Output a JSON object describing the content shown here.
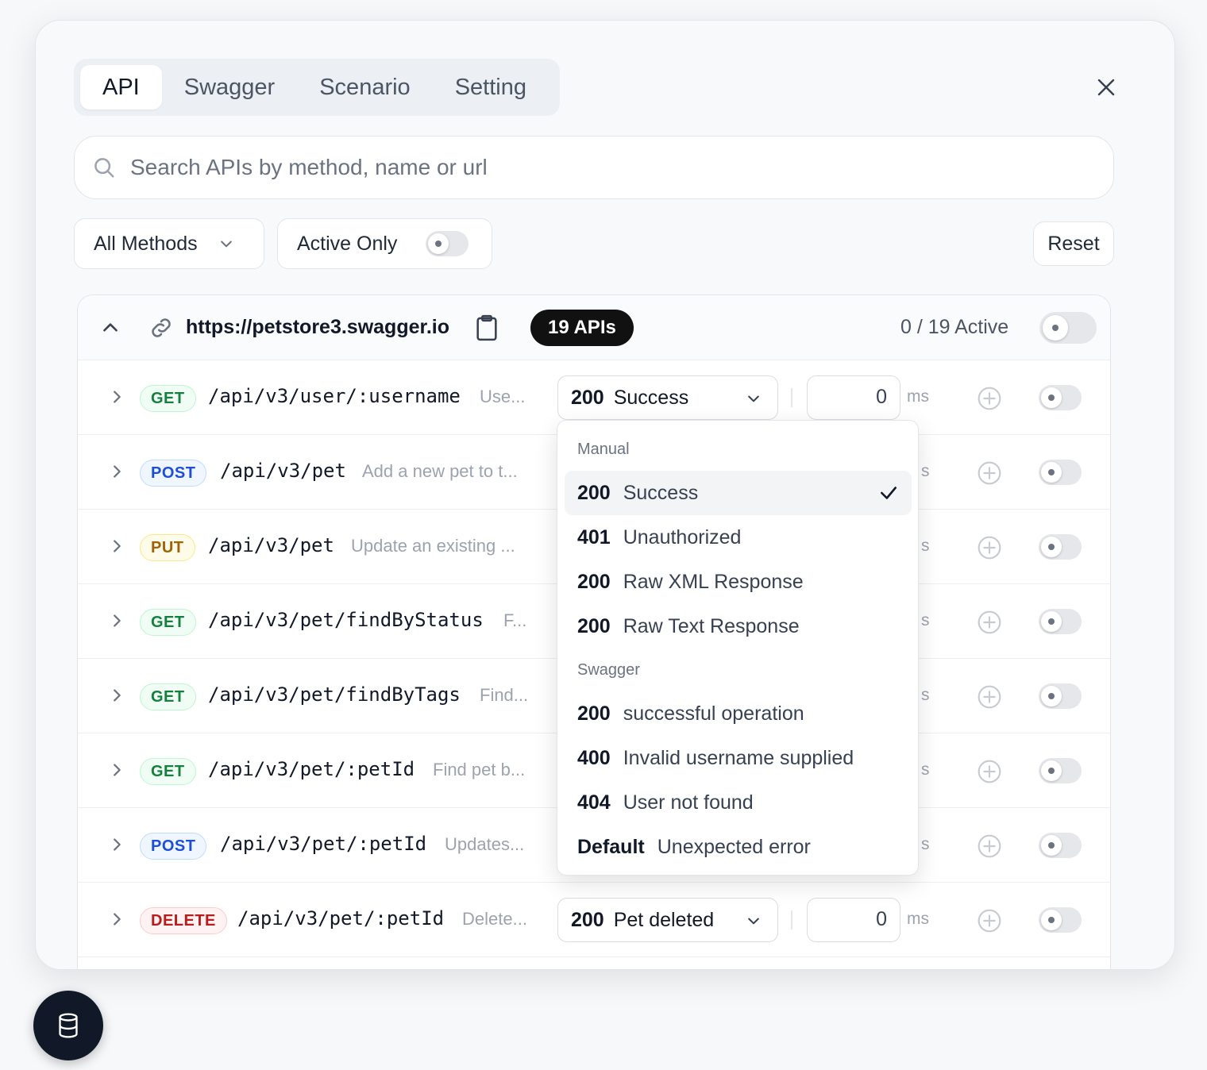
{
  "tabs": [
    {
      "label": "API",
      "active": true
    },
    {
      "label": "Swagger",
      "active": false
    },
    {
      "label": "Scenario",
      "active": false
    },
    {
      "label": "Setting",
      "active": false
    }
  ],
  "search": {
    "placeholder": "Search APIs by method, name or url",
    "value": ""
  },
  "filters": {
    "methods_label": "All Methods",
    "active_only_label": "Active Only",
    "active_only_on": false,
    "reset_label": "Reset"
  },
  "group": {
    "url": "https://petstore3.swagger.io",
    "count_badge": "19 APIs",
    "active_status": "0 / 19 Active",
    "enabled": false
  },
  "rows": [
    {
      "method": "GET",
      "path": "/api/v3/user/:username",
      "desc": "Use...",
      "resp_code": "200",
      "resp_label": "Success",
      "delay": "0",
      "unit": "ms"
    },
    {
      "method": "POST",
      "path": "/api/v3/pet",
      "desc": "Add a new pet to t...",
      "unit": "s"
    },
    {
      "method": "PUT",
      "path": "/api/v3/pet",
      "desc": "Update an existing ...",
      "unit": "s"
    },
    {
      "method": "GET",
      "path": "/api/v3/pet/findByStatus",
      "desc": "F...",
      "unit": "s"
    },
    {
      "method": "GET",
      "path": "/api/v3/pet/findByTags",
      "desc": "Find...",
      "unit": "s"
    },
    {
      "method": "GET",
      "path": "/api/v3/pet/:petId",
      "desc": "Find pet b...",
      "unit": "s"
    },
    {
      "method": "POST",
      "path": "/api/v3/pet/:petId",
      "desc": "Updates...",
      "unit": "s"
    },
    {
      "method": "DELETE",
      "path": "/api/v3/pet/:petId",
      "desc": "Delete...",
      "resp_code": "200",
      "resp_label": "Pet deleted",
      "delay": "0",
      "unit": "ms"
    }
  ],
  "dropdown": {
    "sections": [
      "Manual",
      "Swagger"
    ],
    "manual": [
      {
        "code": "200",
        "label": "Success",
        "selected": true
      },
      {
        "code": "401",
        "label": "Unauthorized"
      },
      {
        "code": "200",
        "label": "Raw XML Response"
      },
      {
        "code": "200",
        "label": "Raw Text Response"
      }
    ],
    "swagger": [
      {
        "code": "200",
        "label": "successful operation"
      },
      {
        "code": "400",
        "label": "Invalid username supplied"
      },
      {
        "code": "404",
        "label": "User not found"
      },
      {
        "code": "Default",
        "label": "Unexpected error"
      }
    ]
  },
  "colors": {
    "get": "#15803d",
    "post": "#1d4ed8",
    "put": "#a16207",
    "delete": "#b91c1c",
    "fab": "#111827"
  },
  "icons": {
    "close": "close-icon",
    "search": "search-icon",
    "link": "link-icon",
    "clipboard": "clipboard-icon",
    "fab": "database-icon"
  }
}
